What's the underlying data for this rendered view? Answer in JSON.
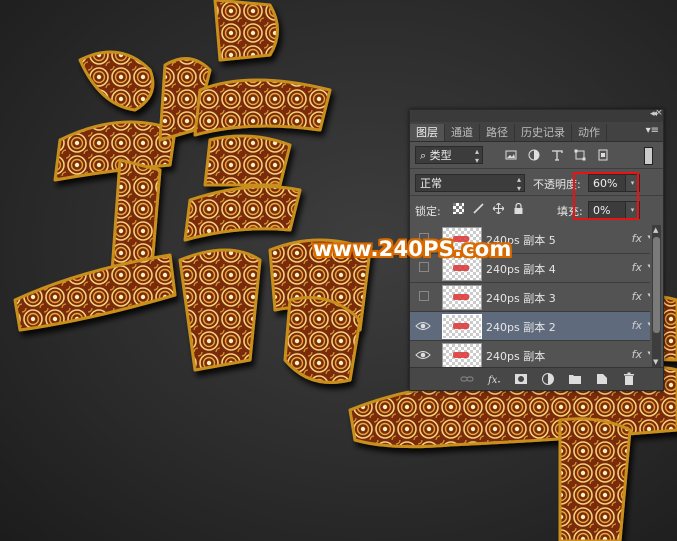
{
  "watermark": "www.240PS.com",
  "panel": {
    "tabs": [
      "图层",
      "通道",
      "路径",
      "历史记录",
      "动作"
    ],
    "active_tab": 0,
    "filter": {
      "kind": "类型"
    },
    "blend_mode": "正常",
    "opacity": {
      "label": "不透明度:",
      "value": "60%"
    },
    "lock_label": "锁定:",
    "fill": {
      "label": "填充:",
      "value": "0%"
    },
    "layers": [
      {
        "name": "240ps  副本 5",
        "visible": false,
        "selected": false,
        "fx": "fx"
      },
      {
        "name": "240ps  副本 4",
        "visible": false,
        "selected": false,
        "fx": "fx"
      },
      {
        "name": "240ps  副本 3",
        "visible": false,
        "selected": false,
        "fx": "fx"
      },
      {
        "name": "240ps  副本 2",
        "visible": true,
        "selected": true,
        "fx": "fx"
      },
      {
        "name": "240ps  副本",
        "visible": true,
        "selected": false,
        "fx": "fx"
      }
    ],
    "footer_icons": [
      "link-icon",
      "fx-icon",
      "mask-icon",
      "adjustment-icon",
      "folder-icon",
      "new-layer-icon",
      "trash-icon"
    ]
  },
  "colors": {
    "panel_bg": "#535353",
    "selected_row": "#5f6b7d",
    "highlight_box": "#ee1111",
    "watermark_stroke": "#d86a00"
  }
}
